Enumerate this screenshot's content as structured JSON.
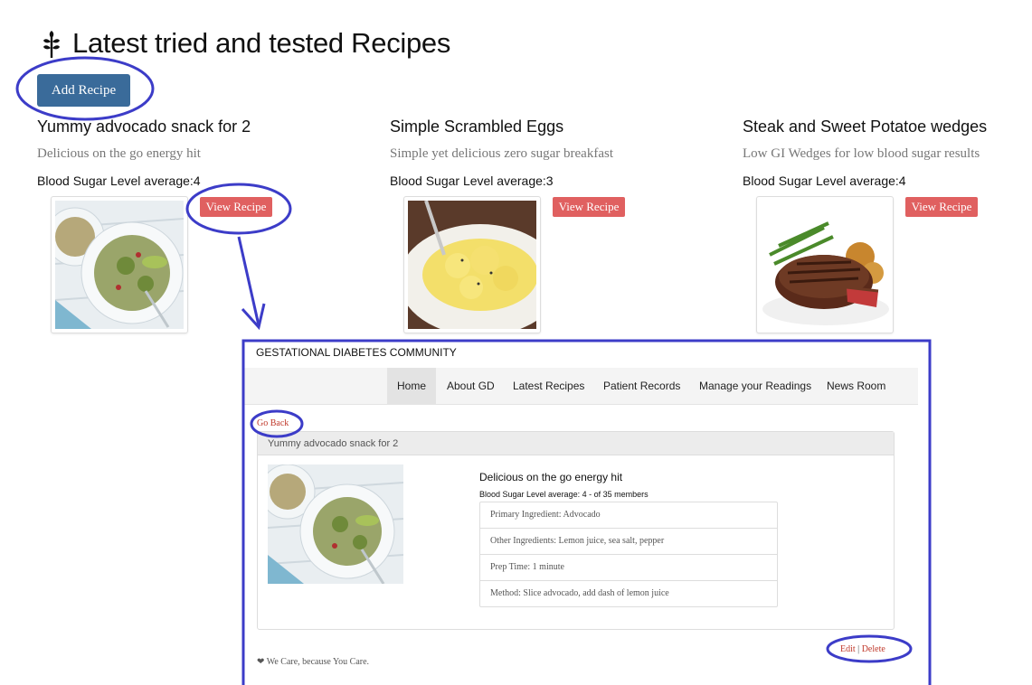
{
  "page": {
    "title": "Latest tried and tested Recipes",
    "add_button": "Add Recipe"
  },
  "recipes": [
    {
      "title": "Yummy advocado snack for 2",
      "subtitle": "Delicious on the go energy hit",
      "blood_sugar": "Blood Sugar Level average:4",
      "view_label": "View Recipe"
    },
    {
      "title": "Simple Scrambled Eggs",
      "subtitle": "Simple yet delicious zero sugar breakfast",
      "blood_sugar": "Blood Sugar Level average:3",
      "view_label": "View Recipe"
    },
    {
      "title": "Steak and Sweet Potatoe wedges",
      "subtitle": "Low GI Wedges for low blood sugar results",
      "blood_sugar": "Blood Sugar Level average:4",
      "view_label": "View Recipe"
    }
  ],
  "detail": {
    "site_name": "GESTATIONAL DIABETES COMMUNITY",
    "nav": [
      "Home",
      "About GD",
      "Latest Recipes",
      "Patient Records",
      "Manage your Readings",
      "News Room"
    ],
    "active_nav": "Home",
    "go_back": "Go Back",
    "panel_title": "Yummy advocado snack for 2",
    "description": "Delicious on the go energy hit",
    "blood_sugar": "Blood Sugar Level average: 4 - of 35 members",
    "fields": [
      "Primary Ingredient: Advocado",
      "Other Ingredients: Lemon juice, sea salt, pepper",
      "Prep Time: 1 minute",
      "Method: Slice advocado, add dash of lemon juice"
    ],
    "edit": "Edit",
    "separator": "|",
    "delete": "Delete",
    "footer": "We Care, because You Care."
  },
  "colors": {
    "primary_button": "#3a6b9a",
    "view_button": "#e06060",
    "annotation": "#3c3cc8",
    "link": "#c0392b"
  }
}
